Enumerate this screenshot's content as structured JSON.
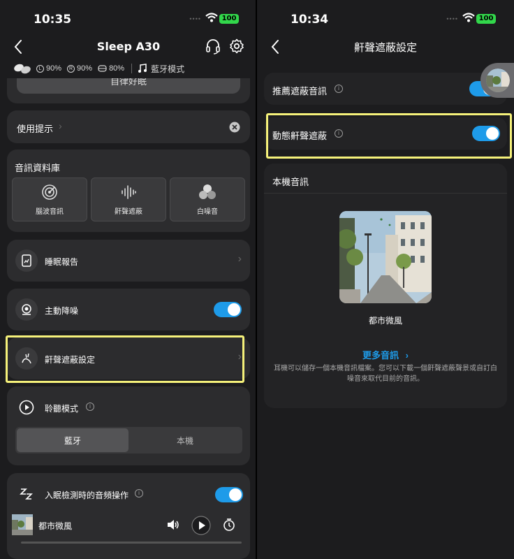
{
  "left": {
    "status": {
      "time": "10:35",
      "battery": "100"
    },
    "header": {
      "title": "Sleep A30"
    },
    "device_info": {
      "left_label": "L",
      "left_value": "90%",
      "right_label": "R",
      "right_value": "90%",
      "case_value": "80%",
      "mode": "藍牙模式"
    },
    "partial_button": "自律好眠",
    "tips": {
      "label": "使用提示"
    },
    "library": {
      "title": "音訊資料庫",
      "tiles": [
        {
          "label": "腦波音訊",
          "icon": "brainwave-icon"
        },
        {
          "label": "鼾聲遮蔽",
          "icon": "soundwave-icon"
        },
        {
          "label": "白噪音",
          "icon": "white-noise-icon"
        }
      ]
    },
    "sleep_report": {
      "label": "睡眠報告"
    },
    "anc": {
      "label": "主動降噪",
      "on": true
    },
    "snore_settings": {
      "label": "鼾聲遮蔽設定"
    },
    "listen_mode": {
      "label": "聆聽模式",
      "options": [
        "藍牙",
        "本機"
      ],
      "selected": "藍牙"
    },
    "sleep_detect": {
      "label": "入眠檢測時的音頻操作",
      "on": true
    },
    "player": {
      "track": "都市微風"
    }
  },
  "right": {
    "status": {
      "time": "10:34",
      "battery": "100"
    },
    "header": {
      "title": "鼾聲遮蔽設定"
    },
    "recommended": {
      "label": "推薦遮蔽音訊",
      "on": true
    },
    "dynamic": {
      "label": "動態鼾聲遮蔽",
      "on": true
    },
    "local_audio": {
      "title": "本機音訊",
      "track": "都市微風",
      "more_label": "更多音訊",
      "description": "耳機可以儲存一個本機音訊檔案。您可以下載一個鼾聲遮蔽聲景或自訂白噪音來取代目前的音訊。"
    }
  },
  "colors": {
    "accent": "#1e9be9",
    "highlight": "#f5f17a",
    "battery": "#32d74b"
  }
}
